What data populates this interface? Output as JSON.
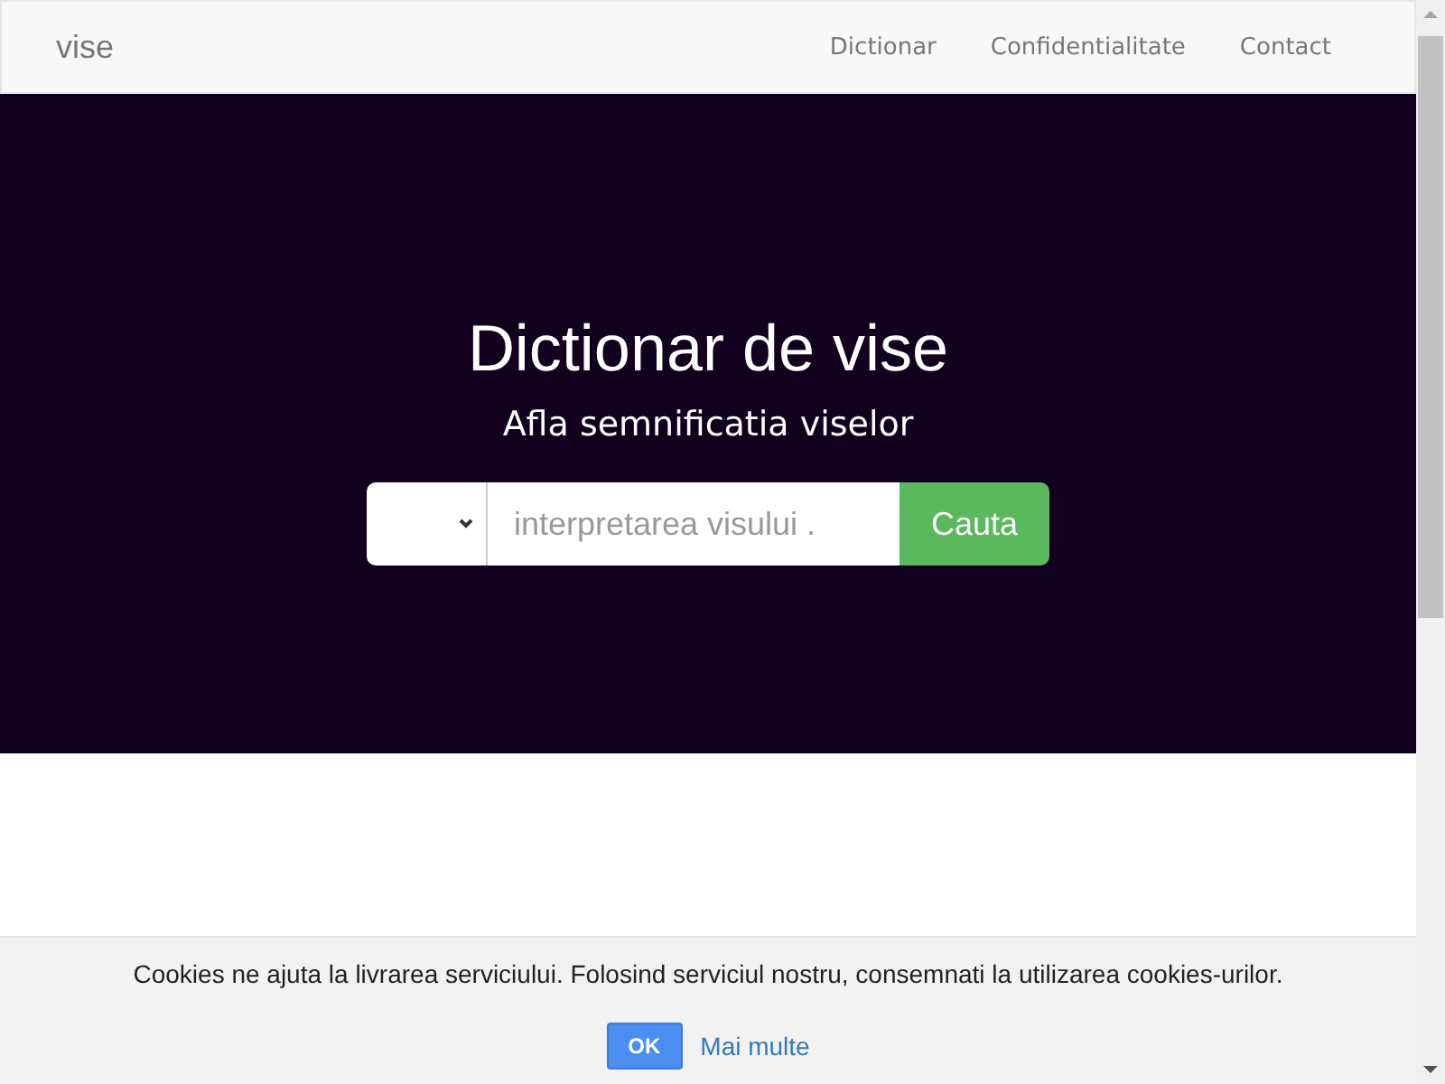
{
  "navbar": {
    "brand": "vise",
    "links": [
      "Dictionar",
      "Confidentialitate",
      "Contact"
    ]
  },
  "hero": {
    "title": "Dictionar de vise",
    "subtitle": "Afla semnificatia viselor",
    "search": {
      "placeholder": "interpretarea visului .",
      "button": "Cauta"
    }
  },
  "cookie_bar": {
    "message": "Cookies ne ajuta la livrarea serviciului. Folosind serviciul nostru, consemnati la utilizarea cookies-urilor.",
    "ok_button": "OK",
    "more_link": "Mai multe"
  }
}
